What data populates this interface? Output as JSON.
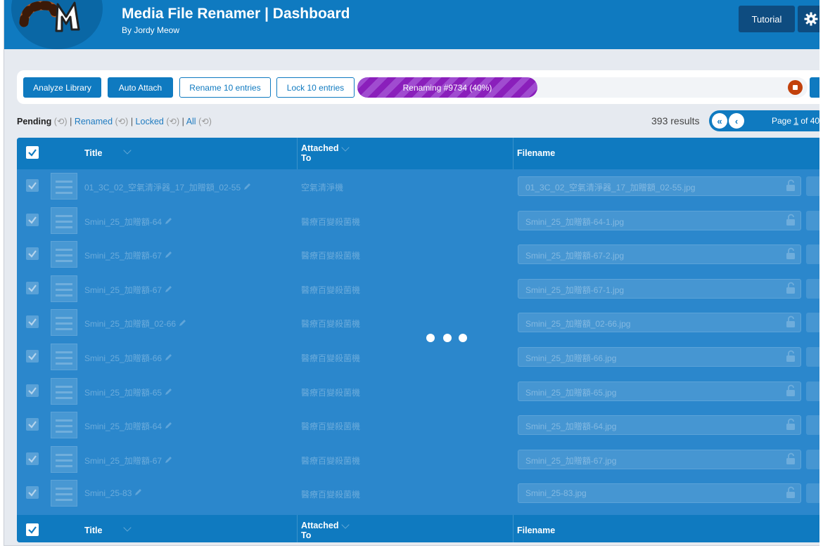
{
  "header": {
    "title": "Media File Renamer | Dashboard",
    "subtitle": "By Jordy Meow",
    "tutorial_label": "Tutorial",
    "brand_color": "#0f7ac0"
  },
  "toolbar": {
    "analyze_label": "Analyze Library",
    "auto_attach_label": "Auto Attach",
    "rename_label": "Rename 10 entries",
    "lock_label": "Lock 10 entries",
    "progress_label": "Renaming #9734 (40%)",
    "progress_percent": 40,
    "progress_color": "#8a1fbb"
  },
  "filters": {
    "pending": "Pending",
    "renamed": "Renamed",
    "locked": "Locked",
    "all": "All",
    "separator": "|"
  },
  "results": "393 results",
  "pagination": {
    "page_prefix": "Page ",
    "current_page": "1",
    "page_suffix": " of 40"
  },
  "table": {
    "columns": {
      "title": "Title",
      "attached_to": "Attached To",
      "attached_line1": "Attached",
      "attached_line2": "To",
      "filename": "Filename"
    },
    "rows": [
      {
        "title": "01_3C_02_空氣清淨器_17_加贈額_02-55",
        "attached": "空氣清淨機",
        "filename": "01_3C_02_空氣清淨器_17_加贈額_02-55.jpg"
      },
      {
        "title": "Smini_25_加贈額-64",
        "attached": "醫療百變殺菌機",
        "filename": "Smini_25_加贈額-64-1.jpg"
      },
      {
        "title": "Smini_25_加贈額-67",
        "attached": "醫療百變殺菌機",
        "filename": "Smini_25_加贈額-67-2.jpg"
      },
      {
        "title": "Smini_25_加贈額-67",
        "attached": "醫療百變殺菌機",
        "filename": "Smini_25_加贈額-67-1.jpg"
      },
      {
        "title": "Smini_25_加贈額_02-66",
        "attached": "醫療百變殺菌機",
        "filename": "Smini_25_加贈額_02-66.jpg"
      },
      {
        "title": "Smini_25_加贈額-66",
        "attached": "醫療百變殺菌機",
        "filename": "Smini_25_加贈額-66.jpg"
      },
      {
        "title": "Smini_25_加贈額-65",
        "attached": "醫療百變殺菌機",
        "filename": "Smini_25_加贈額-65.jpg"
      },
      {
        "title": "Smini_25_加贈額-64",
        "attached": "醫療百變殺菌機",
        "filename": "Smini_25_加贈額-64.jpg"
      },
      {
        "title": "Smini_25_加贈額-67",
        "attached": "醫療百變殺菌機",
        "filename": "Smini_25_加贈額-67.jpg"
      },
      {
        "title": "Smini_25-83",
        "attached": "醫療百變殺菌機",
        "filename": "Smini_25-83.jpg"
      }
    ]
  },
  "icons": {
    "logo": "meow-logo",
    "settings": "gear-icon",
    "stop": "stop-icon",
    "refresh": "refresh-icon",
    "first_page": "double-chevron-left-icon",
    "prev_page": "chevron-left-icon",
    "edit": "pencil-icon",
    "lock": "lock-icon",
    "loading": "loading-dots-icon"
  }
}
